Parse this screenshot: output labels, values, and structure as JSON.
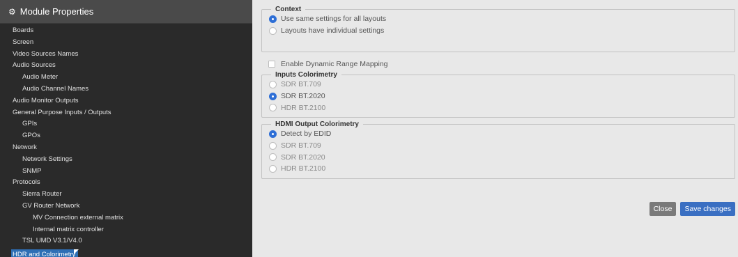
{
  "sidebar": {
    "title": "Module Properties",
    "title_icon": "gears-icon",
    "items": [
      {
        "label": "Boards",
        "level": 0
      },
      {
        "label": "Screen",
        "level": 0
      },
      {
        "label": "Video Sources Names",
        "level": 0
      },
      {
        "label": "Audio Sources",
        "level": 0
      },
      {
        "label": "Audio Meter",
        "level": 1
      },
      {
        "label": "Audio Channel Names",
        "level": 1
      },
      {
        "label": "Audio Monitor Outputs",
        "level": 0
      },
      {
        "label": "General Purpose Inputs / Outputs",
        "level": 0
      },
      {
        "label": "GPIs",
        "level": 1
      },
      {
        "label": "GPOs",
        "level": 1
      },
      {
        "label": "Network",
        "level": 0
      },
      {
        "label": "Network Settings",
        "level": 1
      },
      {
        "label": "SNMP",
        "level": 1
      },
      {
        "label": "Protocols",
        "level": 0
      },
      {
        "label": "Sierra Router",
        "level": 1
      },
      {
        "label": "GV Router Network",
        "level": 1
      },
      {
        "label": "MV Connection external matrix",
        "level": 2
      },
      {
        "label": "Internal matrix controller",
        "level": 2
      },
      {
        "label": "TSL UMD V3.1/V4.0",
        "level": 1
      },
      {
        "label": "HDR and Colorimetry",
        "level": 0,
        "active": true
      }
    ]
  },
  "context": {
    "legend": "Context",
    "options": [
      {
        "label": "Use same settings for all layouts",
        "checked": true
      },
      {
        "label": "Layouts have individual settings",
        "checked": false
      }
    ]
  },
  "dynamic_range": {
    "label": "Enable Dynamic Range Mapping",
    "checked": false
  },
  "inputs_colorimetry": {
    "legend": "Inputs Colorimetry",
    "options": [
      {
        "label": "SDR BT.709",
        "checked": false,
        "disabled": true
      },
      {
        "label": "SDR BT.2020",
        "checked": true,
        "disabled": false
      },
      {
        "label": "HDR BT.2100",
        "checked": false,
        "disabled": true
      }
    ]
  },
  "hdmi_colorimetry": {
    "legend": "HDMI Output Colorimetry",
    "options": [
      {
        "label": "Detect by EDID",
        "checked": true,
        "disabled": false
      },
      {
        "label": "SDR BT.709",
        "checked": false,
        "disabled": true
      },
      {
        "label": "SDR BT.2020",
        "checked": false,
        "disabled": true
      },
      {
        "label": "HDR BT.2100",
        "checked": false,
        "disabled": true
      }
    ]
  },
  "actions": {
    "close_label": "Close",
    "save_label": "Save changes"
  },
  "colors": {
    "accent": "#2e6fd6",
    "sidebar_bg": "#2a2a2a",
    "active_item": "#2e6fb5"
  }
}
